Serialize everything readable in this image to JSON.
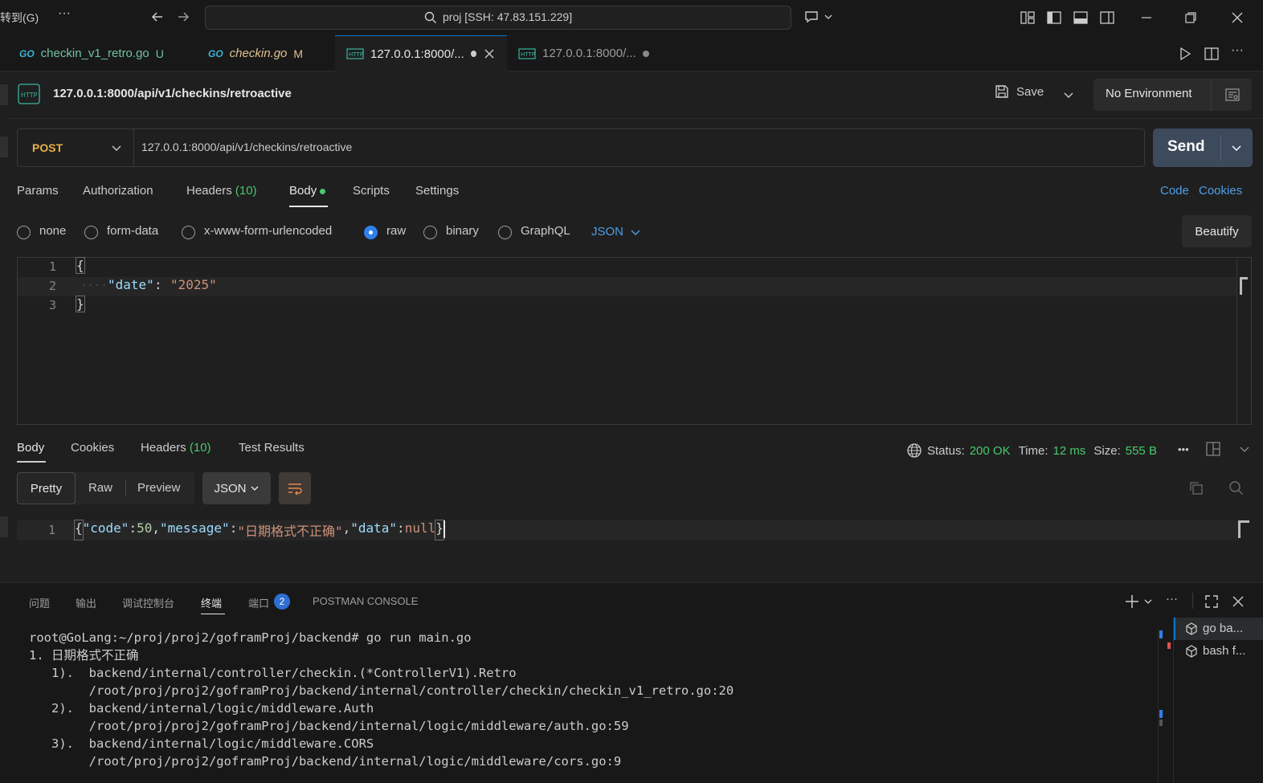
{
  "titlebar": {
    "menu_goto": "转到(G)",
    "menu_more": "···",
    "command_center": "proj [SSH: 47.83.151.229]"
  },
  "tabs": [
    {
      "label": "checkin_v1_retro.go",
      "badge": "U",
      "icon": "go-icon"
    },
    {
      "label": "checkin.go",
      "badge": "M",
      "icon": "go-icon"
    },
    {
      "label": "127.0.0.1:8000/...",
      "icon": "http-icon",
      "active": true
    },
    {
      "label": "127.0.0.1:8000/...",
      "icon": "http-icon"
    }
  ],
  "request": {
    "title": "127.0.0.1:8000/api/v1/checkins/retroactive",
    "save_label": "Save",
    "environment": "No Environment",
    "method": "POST",
    "url": "127.0.0.1:8000/api/v1/checkins/retroactive",
    "send_label": "Send",
    "tabs": {
      "params": "Params",
      "authorization": "Authorization",
      "headers": "Headers",
      "headers_count": "(10)",
      "body": "Body",
      "scripts": "Scripts",
      "settings": "Settings"
    },
    "code_link": "Code",
    "cookies_link": "Cookies",
    "body_types": [
      "none",
      "form-data",
      "x-www-form-urlencoded",
      "raw",
      "binary",
      "GraphQL"
    ],
    "body_type_selected": "raw",
    "format": "JSON",
    "beautify_label": "Beautify",
    "body_lines": [
      "1",
      "2",
      "3"
    ],
    "body_open": "{",
    "body_key": "\"date\"",
    "body_colon": ":",
    "body_value": "\"2025\"",
    "body_close": "}"
  },
  "response": {
    "tabs": {
      "body": "Body",
      "cookies": "Cookies",
      "headers": "Headers",
      "headers_count": "(10)",
      "test_results": "Test Results"
    },
    "status_label": "Status:",
    "status_value": "200 OK",
    "time_label": "Time:",
    "time_value": "12 ms",
    "size_label": "Size:",
    "size_value": "555 B",
    "views": [
      "Pretty",
      "Raw",
      "Preview"
    ],
    "format": "JSON",
    "line_number": "1",
    "json": {
      "p1": "{",
      "k1": "\"code\"",
      "v1": "50",
      "k2": "\"message\"",
      "v2": "\"日期格式不正确\"",
      "k3": "\"data\"",
      "v3": "null",
      "p2": "}"
    }
  },
  "panel": {
    "tabs": [
      "问题",
      "输出",
      "调试控制台",
      "终端",
      "端口",
      "POSTMAN CONSOLE"
    ],
    "selected_tab": "终端",
    "ports_badge": "2",
    "terminal_lines": [
      "root@GoLang:~/proj/proj2/goframProj/backend# go run main.go",
      "1. 日期格式不正确",
      "   1).  backend/internal/controller/checkin.(*ControllerV1).Retro",
      "        /root/proj/proj2/goframProj/backend/internal/controller/checkin/checkin_v1_retro.go:20",
      "   2).  backend/internal/logic/middleware.Auth",
      "        /root/proj/proj2/goframProj/backend/internal/logic/middleware/auth.go:59",
      "   3).  backend/internal/logic/middleware.CORS",
      "        /root/proj/proj2/goframProj/backend/internal/logic/middleware/cors.go:9"
    ],
    "terminals": [
      "go ba...",
      "bash f..."
    ]
  },
  "colors": {
    "accent": "#0078d4",
    "method_post": "#e8b04b",
    "json_key": "#9cdcfe",
    "json_string": "#ce9178",
    "status_ok": "#49c96e",
    "link": "#4d9fe8"
  }
}
